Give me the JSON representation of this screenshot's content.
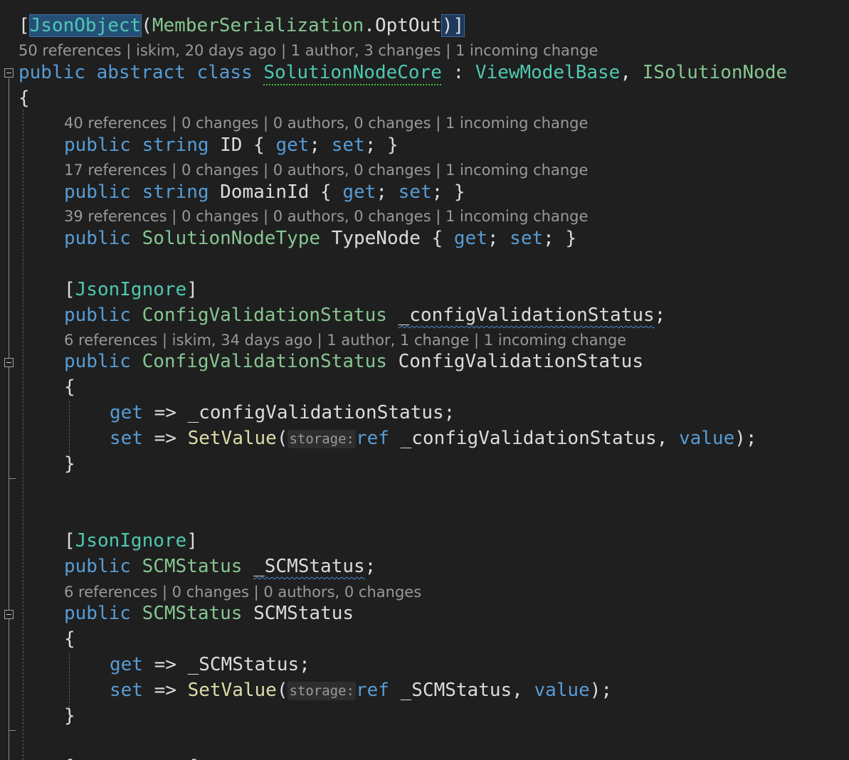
{
  "editor": {
    "attribute_line": {
      "open_bracket": "[",
      "attr_name": "JsonObject",
      "open_paren": "(",
      "enum_type": "MemberSerialization",
      "dot": ".",
      "enum_value": "OptOut",
      "close": ")]"
    },
    "lenses": {
      "class": "50 references | iskim, 20 days ago | 1 author, 3 changes | 1 incoming change",
      "id": "40 references | 0 changes | 0 authors, 0 changes | 1 incoming change",
      "domain_id": "17 references | 0 changes | 0 authors, 0 changes | 1 incoming change",
      "type_node": "39 references | 0 changes | 0 authors, 0 changes | 1 incoming change",
      "config_status": "6 references | iskim, 34 days ago | 1 author, 1 change | 1 incoming change",
      "scm_status": "6 references | 0 changes | 0 authors, 0 changes"
    },
    "class_decl": {
      "kw_public": "public",
      "kw_abstract": "abstract",
      "kw_class": "class",
      "name": "SolutionNodeCore",
      "colon": " : ",
      "base": "ViewModelBase",
      "comma": ", ",
      "iface": "ISolutionNode"
    },
    "open_brace": "{",
    "close_brace": "}",
    "prop_id": {
      "kw_public": "public",
      "type": "string",
      "name": "ID",
      "rest_a": " { ",
      "get": "get",
      "semi1": "; ",
      "set": "set",
      "rest_b": "; }"
    },
    "prop_domain": {
      "kw_public": "public",
      "type": "string",
      "name": "DomainId",
      "rest_a": " { ",
      "get": "get",
      "semi1": "; ",
      "set": "set",
      "rest_b": "; }"
    },
    "prop_typenode": {
      "kw_public": "public",
      "type": "SolutionNodeType",
      "name": "TypeNode",
      "rest_a": " { ",
      "get": "get",
      "semi1": "; ",
      "set": "set",
      "rest_b": "; }"
    },
    "json_ignore_1": {
      "open": "[",
      "name": "JsonIgnore",
      "close": "]"
    },
    "field_config": {
      "kw_public": "public",
      "type": "ConfigValidationStatus",
      "name": "_configValidationStatus",
      "semi": ";"
    },
    "prop_config": {
      "kw_public": "public",
      "type": "ConfigValidationStatus",
      "name": "ConfigValidationStatus"
    },
    "config_get": {
      "kw": "get",
      "arrow": " => ",
      "expr": "_configValidationStatus;"
    },
    "config_set": {
      "kw": "set",
      "arrow": " => ",
      "fn": "SetValue",
      "paren": "(",
      "hint": "storage:",
      "kw_ref": "ref",
      "arg": " _configValidationStatus, ",
      "kw_value": "value",
      "end": ");"
    },
    "json_ignore_2": {
      "open": "[",
      "name": "JsonIgnore",
      "close": "]"
    },
    "field_scm": {
      "kw_public": "public",
      "type": "SCMStatus",
      "name": "_SCMStatus",
      "semi": ";"
    },
    "prop_scm": {
      "kw_public": "public",
      "type": "SCMStatus",
      "name": "SCMStatus"
    },
    "scm_get": {
      "kw": "get",
      "arrow": " => ",
      "expr": "_SCMStatus;"
    },
    "scm_set": {
      "kw": "set",
      "arrow": " => ",
      "fn": "SetValue",
      "paren": "(",
      "hint": "storage:",
      "kw_ref": "ref",
      "arg": " _SCMStatus, ",
      "kw_value": "value",
      "end": ");"
    },
    "partial_next": {
      "open": "[",
      "close": "]"
    }
  },
  "colors": {
    "background": "#1f1f1f",
    "keyword": "#569cd6",
    "type": "#4ec9b0",
    "function": "#dcdcaa",
    "text": "#dcdcdc",
    "codelens": "#999999"
  }
}
